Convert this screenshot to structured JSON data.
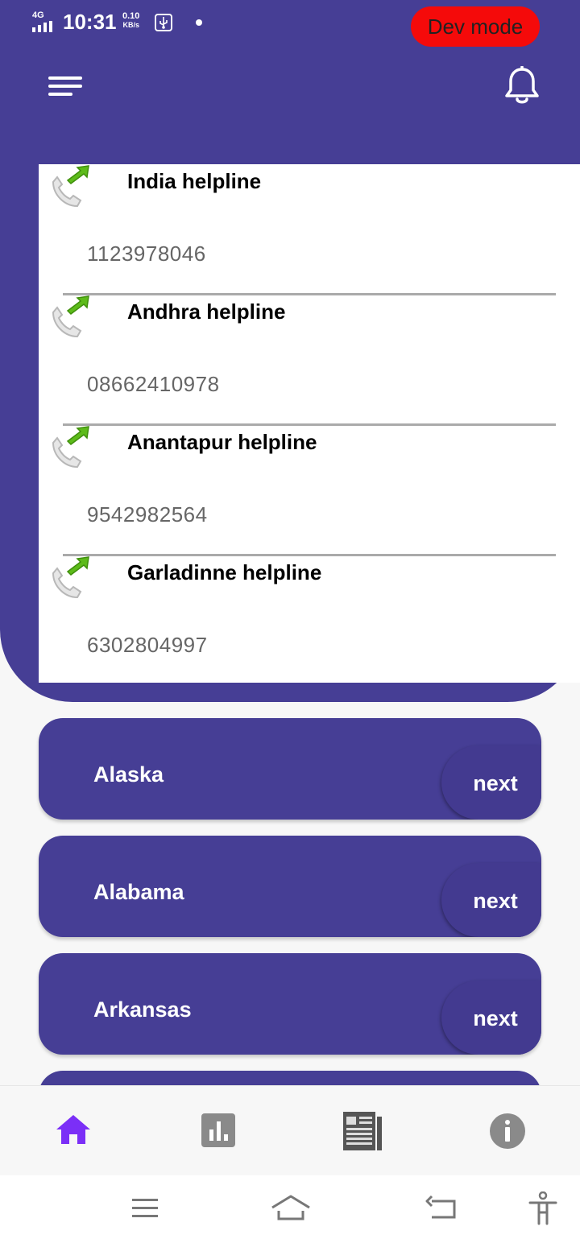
{
  "status_bar": {
    "network": "4G",
    "time": "10:31",
    "speed_value": "0.10",
    "speed_unit": "KB/s"
  },
  "dev_badge": "Dev mode",
  "icons": {
    "menu": "menu-icon",
    "notifications": "bell-icon",
    "call": "outgoing-call-icon"
  },
  "helplines": [
    {
      "title": "India helpline",
      "number": "1123978046"
    },
    {
      "title": "Andhra helpline",
      "number": "08662410978"
    },
    {
      "title": "Anantapur helpline",
      "number": "9542982564"
    },
    {
      "title": "Garladinne helpline",
      "number": "6302804997"
    }
  ],
  "states": [
    {
      "name": "Alaska",
      "action": "next"
    },
    {
      "name": "Alabama",
      "action": "next"
    },
    {
      "name": "Arkansas",
      "action": "next"
    }
  ],
  "bottom_nav": {
    "items": [
      {
        "icon": "home-icon",
        "active": true
      },
      {
        "icon": "stats-icon",
        "active": false
      },
      {
        "icon": "news-icon",
        "active": false
      },
      {
        "icon": "info-icon",
        "active": false
      }
    ],
    "active_color": "#7b2ff7",
    "inactive_color": "#8a8a8a"
  },
  "colors": {
    "primary": "#463e95",
    "badge": "#f50a0a"
  }
}
